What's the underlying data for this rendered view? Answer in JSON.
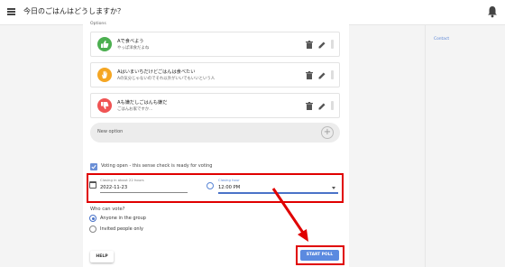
{
  "app": {
    "title": "今日のごはんはどうしますか？"
  },
  "options_label": "Options",
  "options": [
    {
      "title": "Aで食べよう",
      "subtitle": "やっぱ洋食だよね",
      "icon": "thumb-up-icon",
      "color": "#4caf50"
    },
    {
      "title": "Aはいまいちだけどごはんは食べたい",
      "subtitle": "Aの気分じゃないのでそれ以外がいいでもいいという人",
      "icon": "hand-icon",
      "color": "#f5a623"
    },
    {
      "title": "Aも嫌だしごはんも嫌だ",
      "subtitle": "ごはんお家ですか...",
      "icon": "thumb-down-icon",
      "color": "#f05454"
    }
  ],
  "new_option": {
    "placeholder": "New option"
  },
  "voting": {
    "label": "Voting open - this sense check is ready for voting",
    "checked": true
  },
  "closing": {
    "date_label": "Closing in about 22 hours",
    "date_value": "2022-11-23",
    "time_label": "Closing hour",
    "time_value": "12:00 PM"
  },
  "who": {
    "label": "Who can vote?",
    "options": [
      {
        "label": "Anyone in the group",
        "selected": true
      },
      {
        "label": "Invited people only",
        "selected": false
      }
    ]
  },
  "buttons": {
    "help": "HELP",
    "start": "START POLL"
  },
  "sidebar": {
    "contact": "Contact"
  },
  "colors": {
    "accent": "#5b8ae0",
    "highlight": "#e00000"
  }
}
